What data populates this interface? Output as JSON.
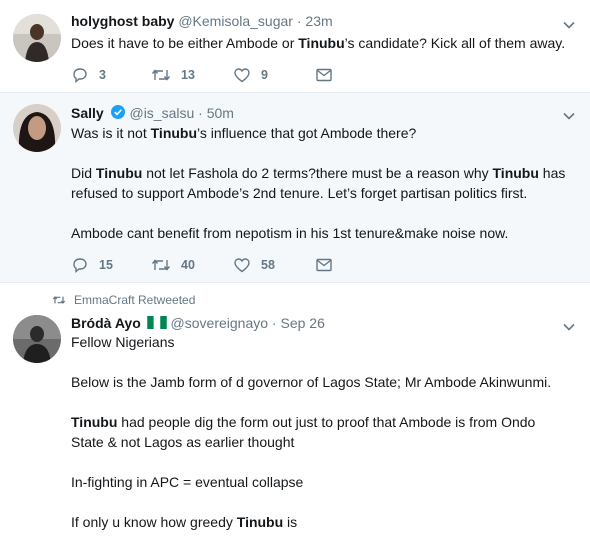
{
  "tweets": [
    {
      "name": "holyghost baby",
      "handle": "@Kemisola_sugar",
      "dot": "·",
      "time": "23m",
      "lines": [
        [
          {
            "t": "Does it have to be either Ambode or "
          },
          {
            "t": "Tinubu",
            "b": true
          },
          {
            "t": "’s candidate? Kick all of them away."
          }
        ]
      ],
      "replies": "3",
      "retweets": "13",
      "likes": "9"
    },
    {
      "name": "Sally",
      "handle": "@is_salsu",
      "dot": "·",
      "time": "50m",
      "verified": true,
      "lines": [
        [
          {
            "t": "Was is it not "
          },
          {
            "t": "Tinubu",
            "b": true
          },
          {
            "t": "’s influence that got Ambode there?"
          }
        ],
        [],
        [
          {
            "t": "Did "
          },
          {
            "t": "Tinubu",
            "b": true
          },
          {
            "t": " not let Fashola do 2 terms?there must be a reason why "
          },
          {
            "t": "Tinubu",
            "b": true
          },
          {
            "t": " has"
          }
        ],
        [
          {
            "t": "refused to support Ambode’s 2nd tenure. Let’s forget partisan politics first."
          }
        ],
        [],
        [
          {
            "t": "Ambode cant benefit from nepotism in his 1st tenure&make noise now."
          }
        ]
      ],
      "replies": "15",
      "retweets": "40",
      "likes": "58"
    },
    {
      "retweet_context": "EmmaCraft Retweeted",
      "name": "Bródà Ayo",
      "flag_emoji": "🇳🇬",
      "handle": "@sovereignayo",
      "dot": "·",
      "time": "Sep 26",
      "lines": [
        [
          {
            "t": "Fellow Nigerians"
          }
        ],
        [],
        [
          {
            "t": "Below is the Jamb form of d governor of Lagos State; Mr Ambode Akinwunmi."
          }
        ],
        [],
        [
          {
            "t": "Tinubu",
            "b": true
          },
          {
            "t": " had people dig the form out just to proof that Ambode is from Ondo"
          }
        ],
        [
          {
            "t": "State & not Lagos as earlier thought"
          }
        ],
        [],
        [
          {
            "t": "In-fighting in APC = eventual collapse"
          }
        ],
        [],
        [
          {
            "t": "If only u know how greedy "
          },
          {
            "t": "Tinubu",
            "b": true
          },
          {
            "t": " is"
          }
        ]
      ]
    }
  ],
  "colors": {
    "text": "#14171a",
    "muted": "#657786",
    "verified": "#1da1f2",
    "divider": "#e6ecf0"
  },
  "icons": [
    "reply-icon",
    "retweet-icon",
    "like-icon",
    "message-icon",
    "chevron-down-icon",
    "verified-badge-icon",
    "nigeria-flag-icon"
  ]
}
